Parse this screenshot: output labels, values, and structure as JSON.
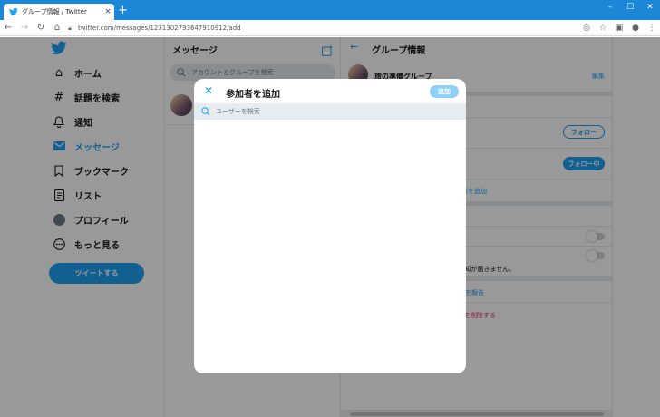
{
  "browser": {
    "tab_title": "グループ情報 / Twitter",
    "tab_close": "×",
    "new_tab": "+",
    "url": "twitter.com/messages/1231302793647910912/add",
    "window_controls": [
      "–",
      "☐",
      "✕"
    ]
  },
  "nav": {
    "items": [
      {
        "label": "ホーム",
        "icon": "home-icon"
      },
      {
        "label": "話題を検索",
        "icon": "hash-icon"
      },
      {
        "label": "通知",
        "icon": "bell-icon"
      },
      {
        "label": "メッセージ",
        "icon": "mail-icon"
      },
      {
        "label": "ブックマーク",
        "icon": "bookmark-icon"
      },
      {
        "label": "リスト",
        "icon": "list-icon"
      },
      {
        "label": "プロフィール",
        "icon": "avatar-icon"
      },
      {
        "label": "もっと見る",
        "icon": "more-icon"
      }
    ],
    "active_index": 3,
    "tweet_button": "ツイートする"
  },
  "messages": {
    "title": "メッセージ",
    "search_placeholder": "アカウントとグループを検索"
  },
  "group_info": {
    "title": "グループ情報",
    "group_name": "旅の準備グループ",
    "edit": "編集",
    "follow": "フォロー",
    "following": "フォロー中",
    "add_members": "加者を追加",
    "notification_text": "ｭ通知が届きません。",
    "report": "話を報告",
    "delete": "を削除する"
  },
  "modal": {
    "title": "参加者を追加",
    "add_button": "追加",
    "search_placeholder": "ユーザーを検索",
    "search_value": ""
  },
  "colors": {
    "brand": "#1da1f2",
    "titlebar": "#1c87d7",
    "danger": "#e0245e"
  }
}
